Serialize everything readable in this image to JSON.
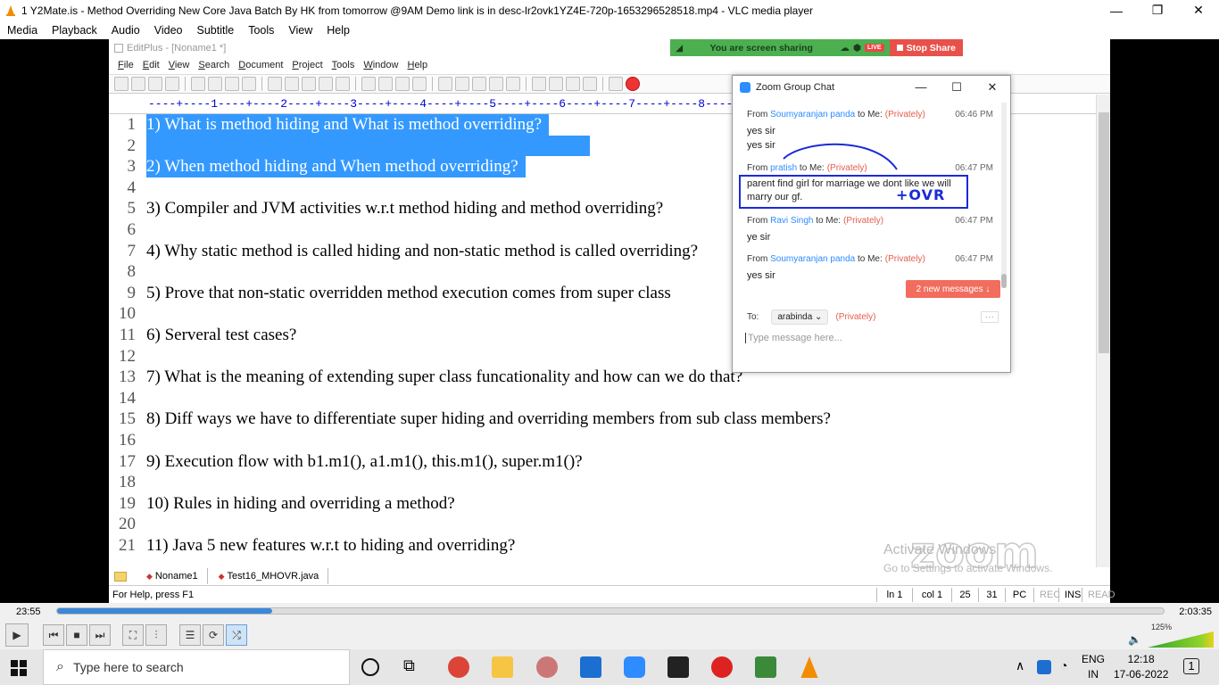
{
  "vlc": {
    "title": "1 Y2Mate.is - Method Overriding  New Core Java Batch By HK from tomorrow @9AM  Demo link is in desc-lr2ovk1YZ4E-720p-1653296528518.mp4 - VLC media player",
    "menu": [
      "Media",
      "Playback",
      "Audio",
      "Video",
      "Subtitle",
      "Tools",
      "View",
      "Help"
    ],
    "time_elapsed": "23:55",
    "time_total": "2:03:35",
    "progress": 0.194,
    "volume": "125%"
  },
  "editplus": {
    "title": "EditPlus - [Noname1 *]",
    "menu": [
      "File",
      "Edit",
      "View",
      "Search",
      "Document",
      "Project",
      "Tools",
      "Window",
      "Help"
    ],
    "ruler": "----+----1----+----2----+----3----+----4----+----5----+----6----+----7----+----8----+----9----+----0----+----1----+----2-",
    "line_numbers": [
      "1",
      "2",
      "3",
      "4",
      "5",
      "6",
      "7",
      "8",
      "9",
      "10",
      "11",
      "12",
      "13",
      "14",
      "15",
      "16",
      "17",
      "18",
      "19",
      "20",
      "21"
    ],
    "lines": [
      "1) What is method hiding and What is method overriding?",
      "",
      "2) When method hiding and When method overriding?",
      "",
      "3) Compiler and JVM activities w.r.t method hiding and method overriding?",
      "",
      "4) Why static method is called hiding and non-static method is called overriding?",
      "",
      "5) Prove that non-static overridden method execution comes from super class",
      "",
      "6) Serveral test cases?",
      "",
      "7) What is the meaning of extending super class funcationality and how can we do that?",
      "",
      "8) Diff ways we have to differentiate super hiding and overriding members from sub class members?",
      "",
      "9) Execution flow with b1.m1(), a1.m1(), this.m1(), super.m1()?",
      "",
      "10) Rules in hiding and overriding a method?",
      "",
      "11) Java 5 new features w.r.t to hiding and overriding?"
    ],
    "tabs": [
      "Noname1",
      "Test16_MHOVR.java"
    ],
    "status": {
      "help": "For Help, press F1",
      "ln": "ln 1",
      "col": "col 1",
      "n1": "25",
      "n2": "31",
      "pc": "PC",
      "rec": "REC",
      "ins": "INS",
      "read": "READ"
    }
  },
  "share": {
    "text": "You are screen sharing",
    "live": "LIVE",
    "stop": "Stop Share"
  },
  "zoom_chat": {
    "title": "Zoom Group Chat",
    "messages": [
      {
        "from": "From",
        "name": "Soumyaranjan panda",
        "to": "to Me:",
        "priv": "(Privately)",
        "time": "06:46 PM",
        "body": "yes sir\nyes sir"
      },
      {
        "from": "From",
        "name": "pratish",
        "to": "to Me:",
        "priv": "(Privately)",
        "time": "06:47 PM",
        "body": "parent find girl for marriage we dont like we will marry our gf."
      },
      {
        "from": "From",
        "name": "Ravi Singh",
        "to": "to Me:",
        "priv": "(Privately)",
        "time": "06:47 PM",
        "body": "ye sir"
      },
      {
        "from": "From",
        "name": "Soumyaranjan panda",
        "to": "to Me:",
        "priv": "(Privately)",
        "time": "06:47 PM",
        "body": "yes sir"
      }
    ],
    "new_messages": "2 new messages ↓",
    "to_label": "To:",
    "recipient": "arabinda",
    "recipient_priv": "(Privately)",
    "placeholder": "Type message here..."
  },
  "annotation": "+OVR",
  "watermark": {
    "line1": "Activate Windows",
    "line2": "Go to Settings to activate Windows.",
    "logo": "zoom"
  },
  "taskbar": {
    "search_placeholder": "Type here to search",
    "lang1": "ENG",
    "lang2": "IN",
    "time": "12:18",
    "date": "17-06-2022",
    "notification_count": "1"
  }
}
